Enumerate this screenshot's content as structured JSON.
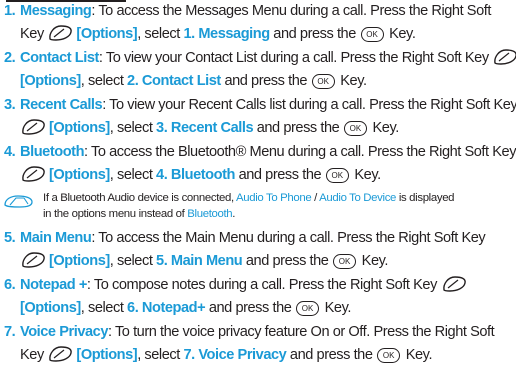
{
  "items": [
    {
      "num": "1.",
      "title": "Messaging",
      "l1a": ": To access the Messages Menu during a call. Press the Right Soft",
      "l2a": "Key ",
      "opt": "[Options]",
      "l2b": ", select ",
      "sel": "1. Messaging",
      "l2c": " and press the ",
      "l2d": " Key."
    },
    {
      "num": "2.",
      "title": "Contact List",
      "l1a": ": To view your Contact List during a call. Press the Right Soft Key",
      "opt": "[Options]",
      "l2b": ", select ",
      "sel": "2. Contact List",
      "l2c": " and press the ",
      "l2d": " Key."
    },
    {
      "num": "3.",
      "title": "Recent Calls",
      "l1a": ": To view your Recent Calls list during a call. Press the Right Soft Key",
      "opt": "[Options]",
      "l2b": ", select ",
      "sel": "3. Recent Calls",
      "l2c": " and press the ",
      "l2d": " Key."
    },
    {
      "num": "4.",
      "title": "Bluetooth",
      "l1a": ": To access the Bluetooth® Menu during a call. Press the Right Soft Key",
      "opt": "[Options]",
      "l2b": ", select ",
      "sel": "4. Bluetooth",
      "l2c": " and press the ",
      "l2d": " Key."
    },
    {
      "num": "5.",
      "title": "Main Menu",
      "l1a": ": To access the Main Menu during a call. Press the Right Soft Key",
      "opt": "[Options]",
      "l2b": ", select ",
      "sel": "5. Main Menu",
      "l2c": " and press the ",
      "l2d": " Key."
    },
    {
      "num": "6.",
      "title": "Notepad +",
      "l1a": ": To compose notes during a call. Press the Right Soft Key",
      "opt": "[Options]",
      "l2b": ", select ",
      "sel": "6. Notepad+",
      "l2c": " and press the ",
      "l2d": " Key."
    },
    {
      "num": "7.",
      "title": "Voice Privacy",
      "l1a": ": To turn the voice privacy feature On or Off. Press the Right Soft",
      "l2a": "Key ",
      "opt": "[Options]",
      "l2b": ", select ",
      "sel": "7. Voice Privacy",
      "l2c": " and press the ",
      "l2d": " Key."
    }
  ],
  "note": {
    "a": "If a Bluetooth Audio device is connected, ",
    "b": "Audio To Phone",
    "c": " / ",
    "d": "Audio To Device",
    "e": " is displayed",
    "f": "in the options menu instead of ",
    "g": "Bluetooth",
    "h": "."
  },
  "ok_key_label": "OK",
  "colors": {
    "accent": "#1b9ad6",
    "text": "#231f20"
  }
}
